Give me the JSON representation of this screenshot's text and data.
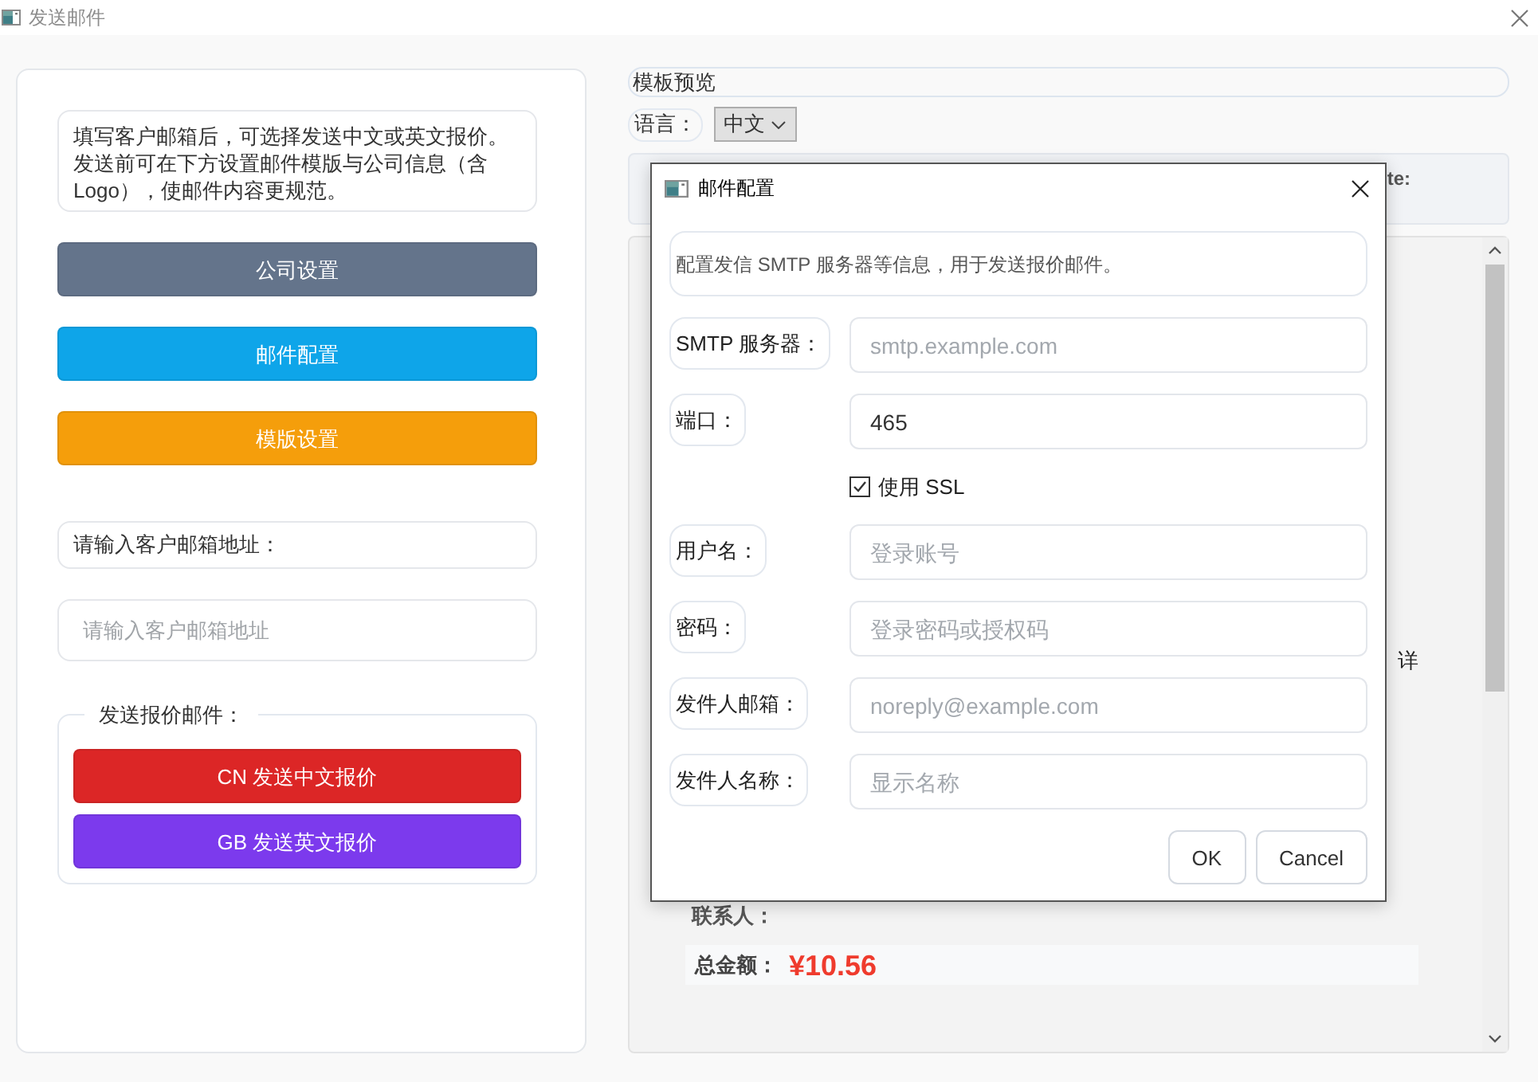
{
  "window": {
    "title": "发送邮件"
  },
  "left_panel": {
    "intro": "填写客户邮箱后，可选择发送中文或英文报价。发送前可在下方设置邮件模版与公司信息（含Logo），使邮件内容更规范。",
    "actions": [
      {
        "label": "公司设置",
        "kind": "secondary"
      },
      {
        "label": "邮件配置",
        "kind": "info"
      },
      {
        "label": "模版设置",
        "kind": "warning"
      }
    ],
    "email_label": "请输入客户邮箱地址：",
    "email_input": {
      "placeholder": "请输入客户邮箱地址"
    },
    "send_group": {
      "title": "发送报价邮件：",
      "buttons": [
        {
          "label": "CN 发送中文报价",
          "kind": "danger"
        },
        {
          "label": "GB 发送英文报价",
          "kind": "accent"
        }
      ]
    }
  },
  "preview": {
    "title": "模板预览",
    "language_label": "语言：",
    "language": "中文",
    "header_text": "te:",
    "detail_text": "详",
    "contact_label": "联系人：",
    "total_label": "总金额：",
    "total_value": "¥10.56"
  },
  "dialog": {
    "title": "邮件配置",
    "info": "配置发信 SMTP 服务器等信息，用于发送报价邮件。",
    "fields": [
      {
        "kind": "input",
        "label": "SMTP 服务器：",
        "placeholder": "smtp.example.com"
      },
      {
        "kind": "input",
        "label": "端口：",
        "value": "465"
      },
      {
        "kind": "checkbox",
        "label": "使用 SSL",
        "checked": true
      },
      {
        "kind": "input",
        "label": "用户名：",
        "placeholder": "登录账号"
      },
      {
        "kind": "password",
        "label": "密码：",
        "placeholder": "登录密码或授权码"
      },
      {
        "kind": "input",
        "label": "发件人邮箱：",
        "placeholder": "noreply@example.com"
      },
      {
        "kind": "input",
        "label": "发件人名称：",
        "placeholder": "显示名称"
      }
    ],
    "buttons": [
      "OK",
      "Cancel"
    ]
  }
}
